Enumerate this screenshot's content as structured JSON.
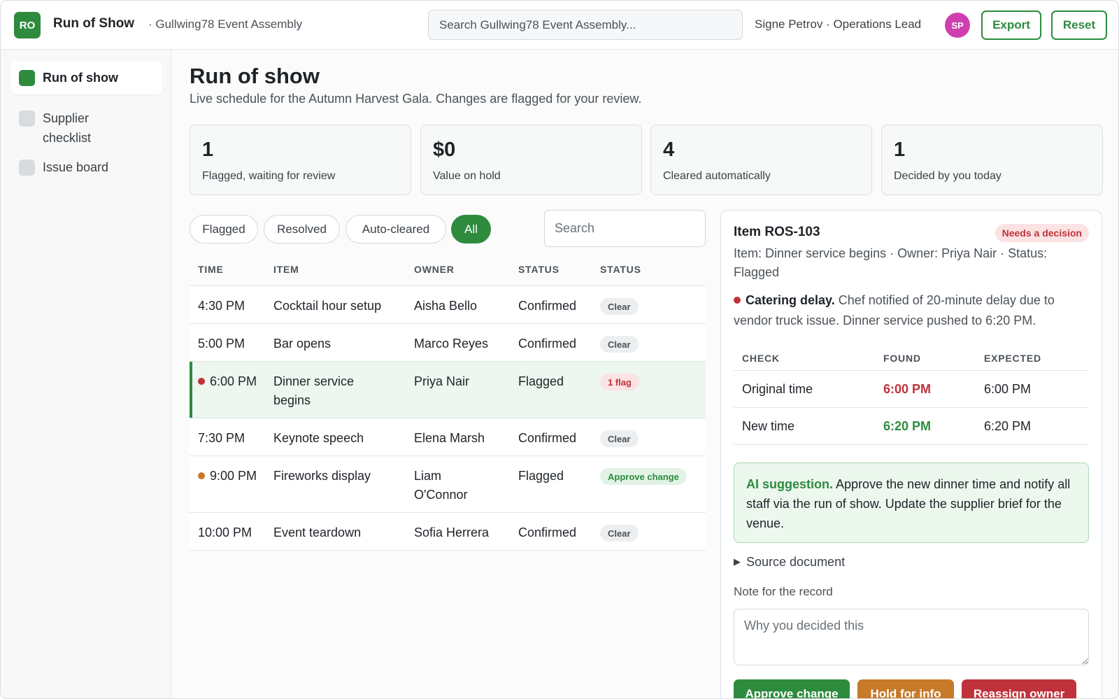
{
  "header": {
    "logo_text": "RO",
    "app_title": "Run of Show",
    "workspace": "· Gullwing78 Event Assembly",
    "search_placeholder": "Search Gullwing78 Event Assembly...",
    "user": "Signe Petrov · Operations Lead",
    "avatar_initials": "SP",
    "export_label": "Export",
    "reset_label": "Reset"
  },
  "sidebar": {
    "items": [
      {
        "label": "Run of show",
        "active": true
      },
      {
        "label": "Supplier checklist",
        "active": false
      },
      {
        "label": "Issue board",
        "active": false
      }
    ]
  },
  "main": {
    "title": "Run of show",
    "subtitle": "Live schedule for the Autumn Harvest Gala. Changes are flagged for your review.",
    "stats": [
      {
        "value": "1",
        "label": "Flagged, waiting for review"
      },
      {
        "value": "$0",
        "label": "Value on hold"
      },
      {
        "value": "4",
        "label": "Cleared automatically"
      },
      {
        "value": "1",
        "label": "Decided by you today"
      }
    ],
    "filters": [
      "Flagged",
      "Resolved",
      "Auto-cleared",
      "All"
    ],
    "active_filter": "All",
    "search_placeholder": "Search",
    "columns": [
      "TIME",
      "ITEM",
      "OWNER",
      "STATUS",
      "STATUS"
    ],
    "rows": [
      {
        "time": "4:30 PM",
        "item": "Cocktail hour setup",
        "owner": "Aisha Bello",
        "status": "Confirmed",
        "badge": "Clear"
      },
      {
        "time": "5:00 PM",
        "item": "Bar opens",
        "owner": "Marco Reyes",
        "status": "Confirmed",
        "badge": "Clear"
      },
      {
        "time": "6:00 PM",
        "item": "Dinner service begins",
        "owner": "Priya Nair",
        "status": "Flagged",
        "badge": "1 flag"
      },
      {
        "time": "7:30 PM",
        "item": "Keynote speech",
        "owner": "Elena Marsh",
        "status": "Confirmed",
        "badge": "Clear"
      },
      {
        "time": "9:00 PM",
        "item": "Fireworks display",
        "owner": "Liam O'Connor",
        "status": "Flagged",
        "badge": "Approve change"
      },
      {
        "time": "10:00 PM",
        "item": "Event teardown",
        "owner": "Sofia Herrera",
        "status": "Confirmed",
        "badge": "Clear"
      }
    ]
  },
  "detail": {
    "title": "Item ROS-103",
    "badge": "Needs a decision",
    "meta": "Item: Dinner service begins · Owner: Priya Nair · Status: Flagged",
    "note_title": "Catering delay.",
    "note_body": "Chef notified of 20-minute delay due to vendor truck issue. Dinner service pushed to 6:20 PM.",
    "check_columns": [
      "CHECK",
      "FOUND",
      "EXPECTED"
    ],
    "checks": [
      {
        "check": "Original time",
        "found": "6:00 PM",
        "expected": "6:00 PM"
      },
      {
        "check": "New time",
        "found": "6:20 PM",
        "expected": "6:20 PM"
      }
    ],
    "ai_title": "AI suggestion.",
    "ai_body": "Approve the new dinner time and notify all staff via the run of show. Update the supplier brief for the venue.",
    "source_label": "Source document",
    "note_label": "Note for the record",
    "note_placeholder": "Why you decided this",
    "actions": {
      "approve": "Approve change",
      "hold": "Hold for info",
      "reassign": "Reassign owner"
    }
  },
  "colors": {
    "accent": "#2e8b3e",
    "danger": "#c0323b",
    "warning": "#c77a2a",
    "avatar": "#cf3fb0"
  }
}
